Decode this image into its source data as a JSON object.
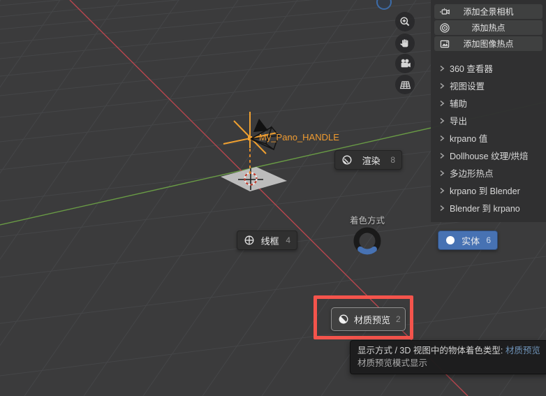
{
  "scene": {
    "object_label": "My_Pano_HANDLE"
  },
  "viewport_controls": [
    {
      "icon": "zoom-in-icon"
    },
    {
      "icon": "pan-hand-icon"
    },
    {
      "icon": "camera-view-icon"
    },
    {
      "icon": "orthographic-grid-icon"
    }
  ],
  "sidebar": {
    "buttons": [
      {
        "label": "添加全景相机",
        "icon": "pano-camera-icon"
      },
      {
        "label": "添加热点",
        "icon": "hotspot-rings-icon"
      },
      {
        "label": "添加图像热点",
        "icon": "image-hotspot-icon"
      }
    ],
    "panels": [
      {
        "label": "360 查看器"
      },
      {
        "label": "视图设置"
      },
      {
        "label": "辅助"
      },
      {
        "label": "导出"
      },
      {
        "label": "krpano 值"
      },
      {
        "label": "Dollhouse 纹理/烘焙"
      },
      {
        "label": "多边形热点"
      },
      {
        "label": "krpano 到 Blender"
      },
      {
        "label": "Blender 到 krpano"
      }
    ]
  },
  "pie_menu": {
    "title": "着色方式",
    "items": [
      {
        "label": "渲染",
        "key": "8",
        "icon": "render-sphere-icon"
      },
      {
        "label": "线框",
        "key": "4",
        "icon": "wireframe-sphere-icon"
      },
      {
        "label": "实体",
        "key": "6",
        "icon": "solid-sphere-icon",
        "selected": true
      },
      {
        "label": "材质预览",
        "key": "2",
        "icon": "material-sphere-icon",
        "hovered": true
      }
    ]
  },
  "tooltip": {
    "line1_prefix": "显示方式 / 3D 视图中的物体着色类型: ",
    "line1_value": "材质预览",
    "line2": "材质预览模式显示"
  },
  "colors": {
    "accent_blue": "#4772b3",
    "annotation_red": "#f4544c",
    "object_label_orange": "#f09b30",
    "axis_x_red": "#b8464e",
    "axis_y_green": "#699b45",
    "viewport_bg": "#3b3b3c"
  }
}
